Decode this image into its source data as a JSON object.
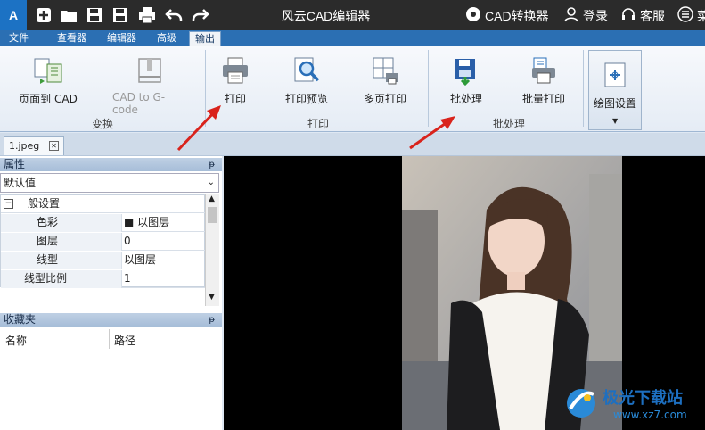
{
  "titlebar": {
    "title": "风云CAD编辑器",
    "converter_label": "CAD转换器",
    "login_label": "登录",
    "service_label": "客服",
    "more_label": "菜"
  },
  "menu": {
    "tabs": [
      "文件",
      "查看器",
      "编辑器",
      "高级",
      "输出"
    ],
    "active_tab": "输出"
  },
  "ribbon": {
    "buttons": {
      "page_to_cad": "页面到 CAD",
      "cad_to_gcode": "CAD to G-code",
      "print": "打印",
      "print_preview": "打印预览",
      "multi_page_print": "多页打印",
      "batch_process": "批处理",
      "batch_print": "批量打印",
      "drawing_settings": "绘图设置"
    },
    "groups": {
      "transform": "变换",
      "print": "打印",
      "batch": "批处理"
    }
  },
  "document": {
    "tab_name": "1.jpeg"
  },
  "properties_panel": {
    "title": "属性",
    "pin": "ᵽ",
    "select_value": "默认值",
    "section": "一般设置",
    "rows": [
      {
        "name": "色彩",
        "value": "■ 以图层"
      },
      {
        "name": "图层",
        "value": "0"
      },
      {
        "name": "线型",
        "value": "以图层"
      },
      {
        "name": "线型比例",
        "value": "1"
      }
    ]
  },
  "favorites_panel": {
    "title": "收藏夹",
    "col_name": "名称",
    "col_path": "路径"
  },
  "watermark": {
    "brand": "极光下载站",
    "url": "www.xz7.com"
  },
  "colors": {
    "titlebar": "#2b2b2b",
    "menubar": "#2b6fb3",
    "accent": "#1c72c4",
    "arrow": "#d9231c"
  }
}
